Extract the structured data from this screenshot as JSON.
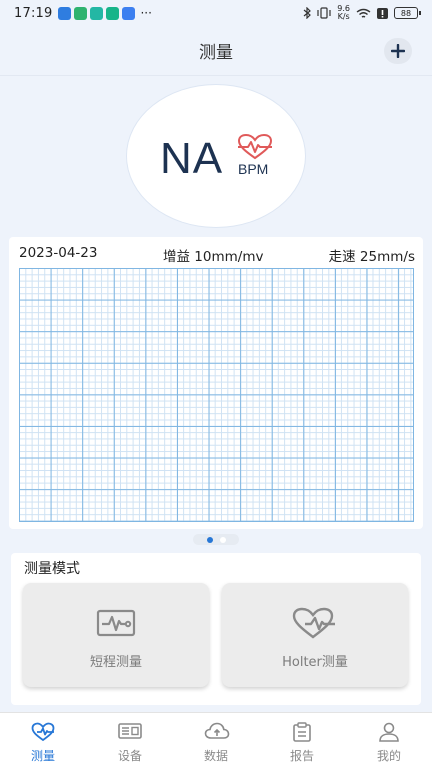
{
  "status_bar": {
    "time": "17:19",
    "net_speed": "9.6\nK/s",
    "battery": "88"
  },
  "header": {
    "title": "测量",
    "add_icon": "plus-icon"
  },
  "heart_rate": {
    "value": "NA",
    "unit": "BPM",
    "icon": "heart-pulse-icon",
    "accent_color": "#e05a5a"
  },
  "ecg": {
    "date": "2023-04-23",
    "gain": "增益 10mm/mv",
    "speed": "走速 25mm/s",
    "grid_color": "#7fb6e2"
  },
  "pager": {
    "count": 2,
    "active_index": 0
  },
  "measure_mode": {
    "title": "测量模式",
    "options": [
      {
        "label": "短程测量",
        "icon": "ecg-monitor-icon"
      },
      {
        "label": "Holter测量",
        "icon": "heart-pulse-icon"
      }
    ]
  },
  "tabs": [
    {
      "label": "测量",
      "icon": "heart-pulse-icon",
      "active": true
    },
    {
      "label": "设备",
      "icon": "device-icon",
      "active": false
    },
    {
      "label": "数据",
      "icon": "cloud-upload-icon",
      "active": false
    },
    {
      "label": "报告",
      "icon": "clipboard-icon",
      "active": false
    },
    {
      "label": "我的",
      "icon": "user-icon",
      "active": false
    }
  ],
  "colors": {
    "primary": "#2777d6",
    "background": "#eef3fb",
    "value_text": "#1d3251"
  }
}
